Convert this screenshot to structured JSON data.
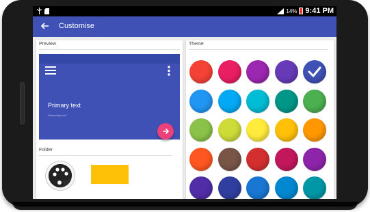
{
  "statusbar": {
    "icons": [
      "usb-icon",
      "sd-card-icon",
      "signal-icon",
      "battery-icon"
    ],
    "battery": "14%",
    "time": "9:41 PM"
  },
  "appbar": {
    "title": "Customise",
    "back_icon": "arrow-back-icon",
    "color": "#3f51b5"
  },
  "preview": {
    "label": "Preview",
    "primary_text": "Primary text",
    "secondary_text": "Secondary text",
    "fab_icon": "arrow-right-icon",
    "fab_color": "#ec407a"
  },
  "folder": {
    "label": "Folder",
    "icon": "palette-icon",
    "color": "#ffc107"
  },
  "theme": {
    "label": "Theme",
    "selected_index": 4,
    "colors": [
      "#f44336",
      "#e91e63",
      "#9c27b0",
      "#673ab7",
      "#3f51b5",
      "#2196f3",
      "#03a9f4",
      "#00bcd4",
      "#009688",
      "#4caf50",
      "#8bc34a",
      "#cddc39",
      "#ffeb3b",
      "#ffc107",
      "#ff9800",
      "#ff5722",
      "#795548",
      "#d32f2f",
      "#c2185b",
      "#8e24aa",
      "#512da8",
      "#303f9f",
      "#1976d2",
      "#0288d1",
      "#0097a7"
    ]
  }
}
